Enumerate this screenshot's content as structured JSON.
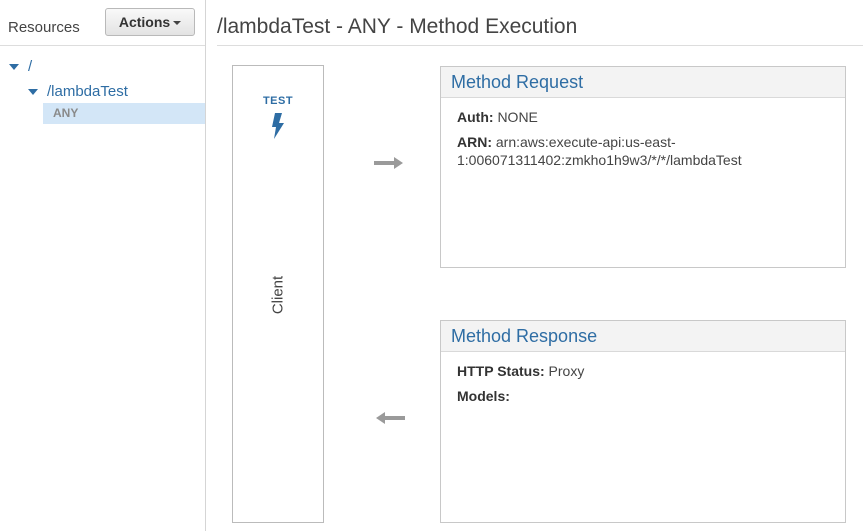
{
  "sidebar": {
    "resources_label": "Resources",
    "actions_label": "Actions",
    "tree": {
      "root": "/",
      "child": "/lambdaTest",
      "method": "ANY"
    }
  },
  "main": {
    "title": "/lambdaTest - ANY - Method Execution",
    "client": {
      "test_label": "TEST",
      "label": "Client"
    },
    "method_request": {
      "title": "Method Request",
      "auth_label": "Auth:",
      "auth_value": "NONE",
      "arn_label": "ARN:",
      "arn_value": "arn:aws:execute-api:us-east-1:006071311402:zmkho1h9w3/*/*/lambdaTest"
    },
    "method_response": {
      "title": "Method Response",
      "http_status_label": "HTTP Status:",
      "http_status_value": "Proxy",
      "models_label": "Models:"
    }
  },
  "colors": {
    "link": "#2e6da4",
    "selected_row": "#d3e6f7",
    "panel_header_bg": "#f3f3f3"
  },
  "icons": [
    "caret-down-icon",
    "lightning-bolt-icon",
    "arrow-right-icon",
    "arrow-left-icon"
  ]
}
